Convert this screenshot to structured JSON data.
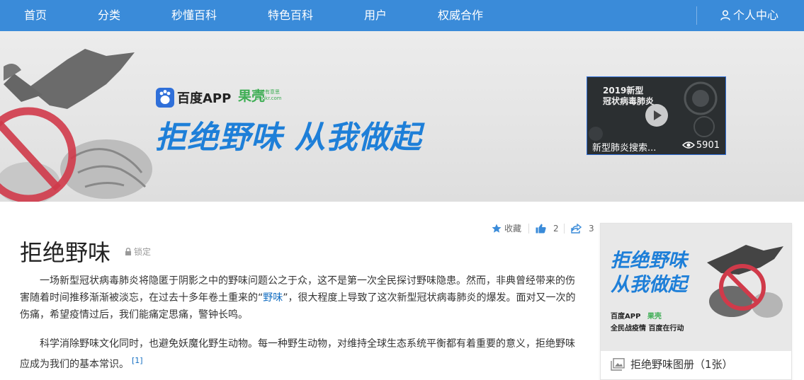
{
  "nav": {
    "items": [
      "首页",
      "分类",
      "秒懂百科",
      "特色百科",
      "用户",
      "权威合作"
    ],
    "user_center": "个人中心"
  },
  "banner": {
    "logo_baidu": "百度APP",
    "logo_guokr": "果壳",
    "logo_guokr_sub": "科技有意思",
    "logo_guokr_url": "Guokr.com",
    "slogan": "拒绝野味 从我做起"
  },
  "video": {
    "title_line1": "2019新型",
    "title_line2": "冠状病毒肺炎",
    "caption": "新型肺炎搜索...",
    "views": "5901"
  },
  "toolbar": {
    "favorite": "收藏",
    "likes": "2",
    "shares": "3"
  },
  "article": {
    "title": "拒绝野味",
    "lock_label": "锁定",
    "p1_before": "一场新型冠状病毒肺炎将隐匿于阴影之中的野味问题公之于众，这不是第一次全民探讨野味隐患。然而，非典曾经带来的伤害随着时间推移渐渐被淡忘，在过去十多年卷土重来的“",
    "p1_link": "野味",
    "p1_after": "”，很大程度上导致了这次新型冠状病毒肺炎的爆发。面对又一次的伤痛，希望疫情过后，我们能痛定思痛，警钟长鸣。",
    "p2": "科学消除野味文化同时，也避免妖魔化野生动物。每一种野生动物，对维持全球生态系统平衡都有着重要的意义，拒绝野味应成为我们的基本常识。",
    "p2_ref": "[1]"
  },
  "album": {
    "slogan_line1": "拒绝野味",
    "slogan_line2": "从我做起",
    "logos_baidu": "百度APP",
    "logos_guokr": "果壳",
    "tagline": "全民战疫情 百度在行动",
    "label": "拒绝野味图册（1张）"
  },
  "colors": {
    "nav_bg": "#3a8bd9",
    "slogan_blue": "#1e7fd8",
    "link": "#136ec2",
    "guokr_green": "#3fae55",
    "forbid_red": "#d03a4a"
  }
}
